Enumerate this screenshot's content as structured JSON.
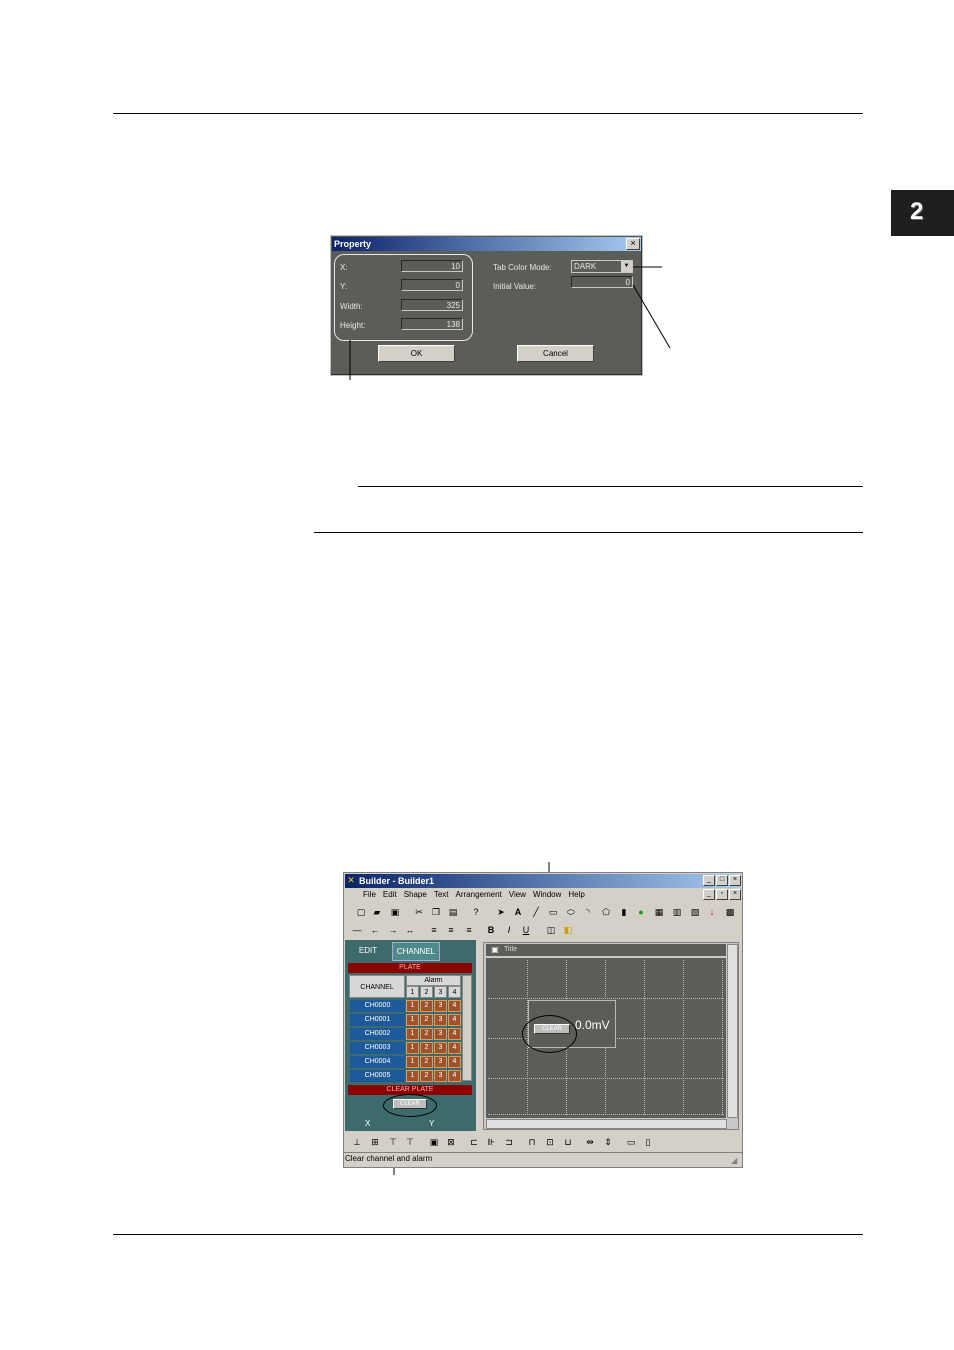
{
  "chapter_tab": "2",
  "property_dialog": {
    "title": "Property",
    "close": "×",
    "fields": [
      {
        "label": "X:",
        "value": "10"
      },
      {
        "label": "Y:",
        "value": "0"
      },
      {
        "label": "Width:",
        "value": "325"
      },
      {
        "label": "Height:",
        "value": "138"
      }
    ],
    "tab_color_mode_label": "Tab Color Mode:",
    "tab_color_mode_value": "DARK",
    "initial_value_label": "Initial Value:",
    "initial_value": "0",
    "ok": "OK",
    "cancel": "Cancel"
  },
  "builder": {
    "title": "Builder - Builder1",
    "menu": [
      "File",
      "Edit",
      "Shape",
      "Text",
      "Arrangement",
      "View",
      "Window",
      "Help"
    ],
    "tabs": [
      "EDIT",
      "CHANNEL"
    ],
    "plate_label": "PLATE",
    "channel_header": "CHANNEL",
    "alarm_header": "Alarm",
    "alarm_numbers": [
      "1",
      "2",
      "3",
      "4"
    ],
    "channels": [
      "CH0000",
      "CH0001",
      "CH0002",
      "CH0003",
      "CH0004",
      "CH0005"
    ],
    "clear_plate_label": "CLEAR PLATE",
    "clear_button": "CLEAR",
    "coord_x": "X",
    "coord_y": "Y",
    "canvas_title": "Title",
    "canvas_clear": "CLEAR",
    "canvas_value": "0.0mV",
    "status_text": "Clear channel and alarm"
  }
}
